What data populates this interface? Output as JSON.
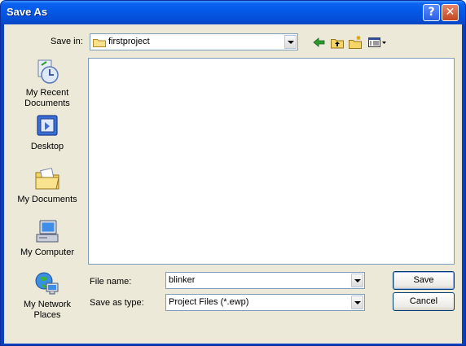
{
  "window": {
    "title": "Save As"
  },
  "titlebar_buttons": {
    "help": "?",
    "close": "✕"
  },
  "toolbar": {
    "save_in_label": "Save in:",
    "save_in_value": "firstproject",
    "back_icon": "back-arrow-icon",
    "up_icon": "up-one-level-icon",
    "new_folder_icon": "new-folder-icon",
    "views_icon": "views-menu-icon"
  },
  "places": [
    {
      "name": "recent",
      "label_line1": "My Recent",
      "label_line2": "Documents",
      "icon": "recent-documents-icon"
    },
    {
      "name": "desktop",
      "label_line1": "Desktop",
      "label_line2": "",
      "icon": "desktop-icon"
    },
    {
      "name": "mydocs",
      "label_line1": "My Documents",
      "label_line2": "",
      "icon": "my-documents-icon"
    },
    {
      "name": "mycomputer",
      "label_line1": "My Computer",
      "label_line2": "",
      "icon": "my-computer-icon"
    },
    {
      "name": "network",
      "label_line1": "My Network",
      "label_line2": "Places",
      "icon": "network-places-icon"
    }
  ],
  "form": {
    "filename_label": "File name:",
    "filename_value": "blinker",
    "filetype_label": "Save as type:",
    "filetype_value": "Project Files (*.ewp)"
  },
  "buttons": {
    "save": "Save",
    "cancel": "Cancel"
  }
}
